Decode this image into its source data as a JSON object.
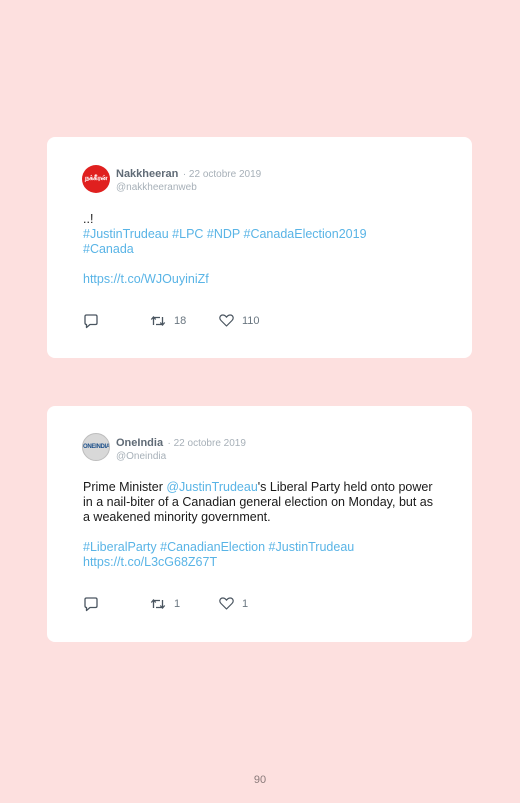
{
  "tweets": [
    {
      "name": "Nakkheeran",
      "date": "· 22 octobre 2019",
      "handle": "@nakkheeranweb",
      "avatar_text": "நக்கீரன்",
      "line1": "..!",
      "hashtags": "#JustinTrudeau #LPC #NDP #CanadaElection2019",
      "hashtags2": "#Canada",
      "url": "https://t.co/WJOuyiniZf",
      "retweets": "18",
      "likes": "110"
    },
    {
      "name": "OneIndia",
      "date": "· 22 octobre 2019",
      "handle": "@Oneindia",
      "avatar_text": "ONEINDIA",
      "text_before": "Prime Minister ",
      "mention": "@JustinTrudeau",
      "text_after": "'s Liberal Party held onto power in a nail-biter of a Canadian general election on Monday, but as a weakened minority government.",
      "hashtags": "#LiberalParty #CanadianElection #JustinTrudeau",
      "url": "https://t.co/L3cG68Z67T",
      "retweets": "1",
      "likes": "1"
    }
  ],
  "page_number": "90",
  "colors": {
    "background": "#fde0df",
    "link": "#59b4e6",
    "muted": "#a7b0b8"
  }
}
